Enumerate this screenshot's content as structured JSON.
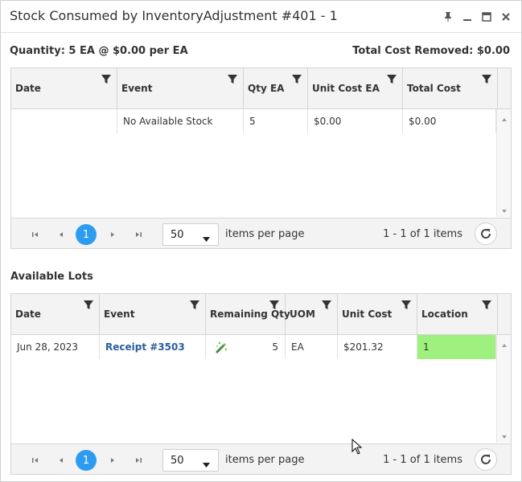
{
  "window": {
    "title": "Stock Consumed by InventoryAdjustment #401 - 1",
    "controls": [
      "pin-icon",
      "minimize-icon",
      "maximize-icon",
      "close-icon"
    ]
  },
  "summary": {
    "quantity": "Quantity: 5  EA  @  $0.00 per EA",
    "total_cost": "Total Cost Removed: $0.00"
  },
  "consumed_grid": {
    "columns": [
      "Date",
      "Event",
      "Qty EA",
      "Unit Cost EA",
      "Total Cost"
    ],
    "rows": [
      {
        "date": "",
        "event": "No Available Stock",
        "qty": "5",
        "unit_cost": "$0.00",
        "total_cost": "$0.00"
      }
    ],
    "pager": {
      "current_page": "1",
      "page_size": "50",
      "per_page_label": "items per page",
      "info": "1 - 1 of 1 items"
    }
  },
  "lots_section": {
    "title": "Available Lots"
  },
  "lots_grid": {
    "columns": [
      "Date",
      "Event",
      "Remaining Qty",
      "UOM",
      "Unit Cost",
      "Location"
    ],
    "rows": [
      {
        "date": "Jun 28, 2023",
        "event": "Receipt #3503",
        "remaining_qty": "5",
        "uom": "EA",
        "unit_cost": "$201.32",
        "location": "1"
      }
    ],
    "pager": {
      "current_page": "1",
      "page_size": "50",
      "per_page_label": "items per page",
      "info": "1 - 1 of 1 items"
    }
  },
  "colors": {
    "accent": "#2d9cf0",
    "location_highlight": "#9ef07f",
    "link": "#2a5d9f"
  }
}
